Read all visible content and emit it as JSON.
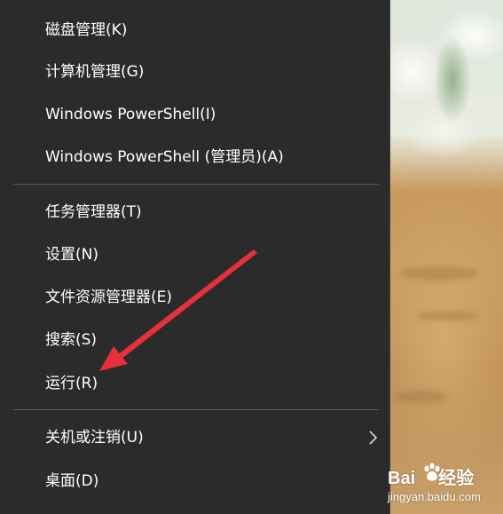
{
  "menu": {
    "items": [
      {
        "label": "磁盘管理(K)"
      },
      {
        "label": "计算机管理(G)"
      },
      {
        "label": "Windows PowerShell(I)"
      },
      {
        "label": "Windows PowerShell (管理员)(A)"
      },
      {
        "label": "任务管理器(T)"
      },
      {
        "label": "设置(N)"
      },
      {
        "label": "文件资源管理器(E)"
      },
      {
        "label": "搜索(S)"
      },
      {
        "label": "运行(R)"
      },
      {
        "label": "关机或注销(U)",
        "submenu_icon": "chevron-right-icon"
      },
      {
        "label": "桌面(D)"
      }
    ],
    "background_color": "#2b2b2b",
    "text_color": "#ffffff"
  },
  "annotation": {
    "icon": "red-arrow-icon",
    "color": "#e8303a",
    "target": "运行(R)"
  },
  "watermark": {
    "brand_left": "Bai",
    "brand_right": "经验",
    "brand_icon": "paw-icon",
    "url": "jingyan.baidu.com"
  }
}
